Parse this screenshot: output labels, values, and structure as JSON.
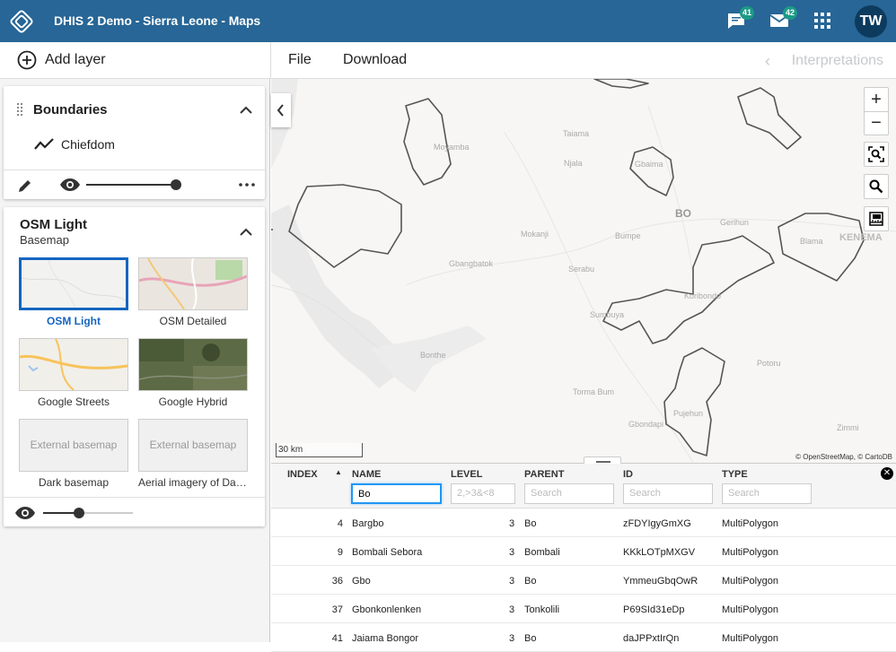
{
  "header": {
    "title": "DHIS 2 Demo - Sierra Leone - Maps",
    "messages_badge": "41",
    "interpretations_badge": "42",
    "avatar_initials": "TW",
    "icons": [
      "dhis2-logo-icon",
      "messages-icon",
      "email-icon",
      "apps-grid-icon"
    ]
  },
  "toolbar": {
    "add_layer_label": "Add layer",
    "file_label": "File",
    "download_label": "Download",
    "interpretations_label": "Interpretations"
  },
  "layers": {
    "boundaries": {
      "title": "Boundaries",
      "legend_label": "Chiefdom",
      "opacity": 1.0
    },
    "basemap": {
      "title": "OSM Light",
      "subtitle": "Basemap",
      "opacity": 0.4,
      "options": [
        {
          "label": "OSM Light",
          "selected": true
        },
        {
          "label": "OSM Detailed",
          "selected": false
        },
        {
          "label": "Google Streets",
          "selected": false
        },
        {
          "label": "Google Hybrid",
          "selected": false
        },
        {
          "label": "Dark basemap",
          "selected": false,
          "thumb_text": "External basemap"
        },
        {
          "label": "Aerial imagery of Dar…",
          "selected": false,
          "thumb_text": "External basemap"
        }
      ]
    }
  },
  "map": {
    "scale_label": "30 km",
    "attribution": "© OpenStreetMap, © CartoDB",
    "place_labels": [
      "Taiama",
      "Moyamba",
      "Njala",
      "Gbaima",
      "BO",
      "Gerihun",
      "Mokanji",
      "Bumpe",
      "Blama",
      "KENEMA",
      "Gbangbatok",
      "Serabu",
      "Koribondo",
      "Sumbuya",
      "Bonthe",
      "Torma Bum",
      "Gbondapi",
      "Pujehun",
      "Potoru",
      "Zimmi"
    ],
    "controls": [
      "zoom-in",
      "zoom-out",
      "fit-bounds",
      "search",
      "measure"
    ]
  },
  "table": {
    "columns": [
      "INDEX",
      "NAME",
      "LEVEL",
      "PARENT",
      "ID",
      "TYPE"
    ],
    "filters": {
      "name": "Bo",
      "level_placeholder": "2,>3&<8",
      "parent_placeholder": "Search",
      "id_placeholder": "Search",
      "type_placeholder": "Search"
    },
    "rows": [
      {
        "index": "4",
        "name": "Bargbo",
        "level": "3",
        "parent": "Bo",
        "id": "zFDYIgyGmXG",
        "type": "MultiPolygon"
      },
      {
        "index": "9",
        "name": "Bombali Sebora",
        "level": "3",
        "parent": "Bombali",
        "id": "KKkLOTpMXGV",
        "type": "MultiPolygon"
      },
      {
        "index": "36",
        "name": "Gbo",
        "level": "3",
        "parent": "Bo",
        "id": "YmmeuGbqOwR",
        "type": "MultiPolygon"
      },
      {
        "index": "37",
        "name": "Gbonkonlenken",
        "level": "3",
        "parent": "Tonkolili",
        "id": "P69SId31eDp",
        "type": "MultiPolygon"
      },
      {
        "index": "41",
        "name": "Jaiama Bongor",
        "level": "3",
        "parent": "Bo",
        "id": "daJPPxtIrQn",
        "type": "MultiPolygon"
      }
    ]
  }
}
